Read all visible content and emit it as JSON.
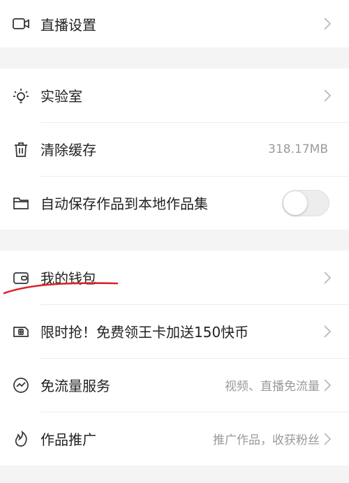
{
  "groups": [
    {
      "rows": [
        {
          "label": "直播设置",
          "icon": "camera-icon",
          "right": "chevron"
        }
      ]
    },
    {
      "rows": [
        {
          "label": "实验室",
          "icon": "lightbulb-icon",
          "right": "chevron"
        },
        {
          "label": "清除缓存",
          "icon": "trash-icon",
          "right": "value",
          "value": "318.17MB"
        },
        {
          "label": "自动保存作品到本地作品集",
          "icon": "folder-icon",
          "right": "toggle",
          "toggle_on": false
        }
      ]
    },
    {
      "rows": [
        {
          "label": "我的钱包",
          "icon": "wallet-icon",
          "right": "chevron"
        },
        {
          "label": "限时抢！免费领王卡加送150快币",
          "icon": "sim-card-icon",
          "right": "chevron"
        },
        {
          "label": "免流量服务",
          "icon": "data-flow-icon",
          "right": "value-chevron",
          "value": "视频、直播免流量"
        },
        {
          "label": "作品推广",
          "icon": "flame-icon",
          "right": "value-chevron",
          "value": "推广作品，收获粉丝"
        }
      ]
    }
  ],
  "colors": {
    "annotation_underline": "#d9262b",
    "icon_stroke": "#333333",
    "secondary_text": "#9a9a9a"
  }
}
